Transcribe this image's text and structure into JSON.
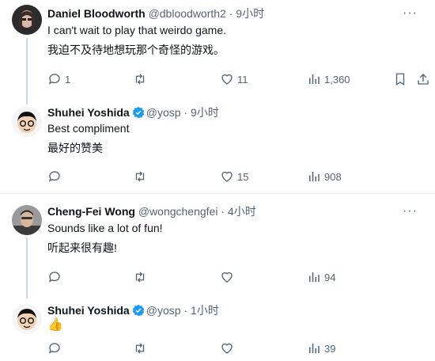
{
  "tweets": [
    {
      "name": "Daniel Bloodworth",
      "handle": "@dbloodworth2",
      "time": "9小时",
      "line1": "I can't wait to play that weirdo game.",
      "line2": "我迫不及待地想玩那个奇怪的游戏。",
      "replies": "1",
      "retweets": "",
      "likes": "11",
      "views": "1,360",
      "verified": false
    },
    {
      "name": "Shuhei Yoshida",
      "handle": "@yosp",
      "time": "9小时",
      "line1": "Best compliment",
      "line2": "最好的赞美",
      "replies": "",
      "retweets": "",
      "likes": "15",
      "views": "908",
      "verified": true
    },
    {
      "name": "Cheng-Fei Wong",
      "handle": "@wongchengfei",
      "time": "4小时",
      "line1": "Sounds like a lot of fun!",
      "line2": "听起来很有趣!",
      "replies": "",
      "retweets": "",
      "likes": "",
      "views": "94",
      "verified": false
    },
    {
      "name": "Shuhei Yoshida",
      "handle": "@yosp",
      "time": "1小时",
      "line1": "👍",
      "replies": "",
      "retweets": "",
      "likes": "",
      "views": "39",
      "verified": true
    }
  ],
  "separator": "·",
  "more": "···",
  "colors": {
    "verified": "#1d9bf0",
    "muted": "#536471",
    "line": "#cfd9de"
  }
}
